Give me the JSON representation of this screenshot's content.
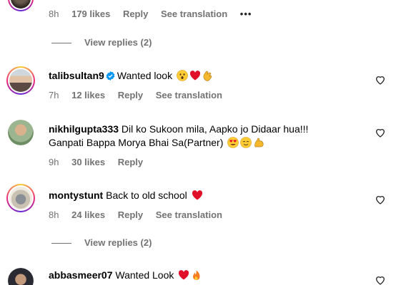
{
  "comments": [
    {
      "time": "8h",
      "likes": "179 likes",
      "reply": "Reply",
      "translation": "See translation",
      "more": "•••"
    },
    {
      "username": "talibsultan9",
      "verified": true,
      "text": "Wanted look",
      "emojis": [
        "astonished-face",
        "red-heart",
        "clapping-hands"
      ],
      "time": "7h",
      "likes": "12 likes",
      "reply": "Reply",
      "translation": "See translation"
    },
    {
      "username": "nikhilgupta333",
      "text_line1": "Dil ko Sukoon mila, Aapko jo Didaar hua!!!",
      "text_line2": "Ganpati Bappa Morya Bhai Sa(Partner)",
      "emojis": [
        "heart-eyes-face",
        "relieved-face",
        "flexed-biceps"
      ],
      "time": "9h",
      "likes": "30 likes",
      "reply": "Reply"
    },
    {
      "username": "montystunt",
      "text": "Back to old school",
      "emojis": [
        "red-heart"
      ],
      "time": "8h",
      "likes": "24 likes",
      "reply": "Reply",
      "translation": "See translation"
    },
    {
      "username": "abbasmeer07",
      "text": "Wanted Look",
      "emojis": [
        "red-heart",
        "fire"
      ]
    }
  ],
  "view_replies": [
    {
      "label": "View replies (2)"
    },
    {
      "label": "View replies (2)"
    }
  ],
  "colors": {
    "secondary_text": "#737373",
    "verified_blue": "#0095f6",
    "heart_red": "#e0102a"
  }
}
